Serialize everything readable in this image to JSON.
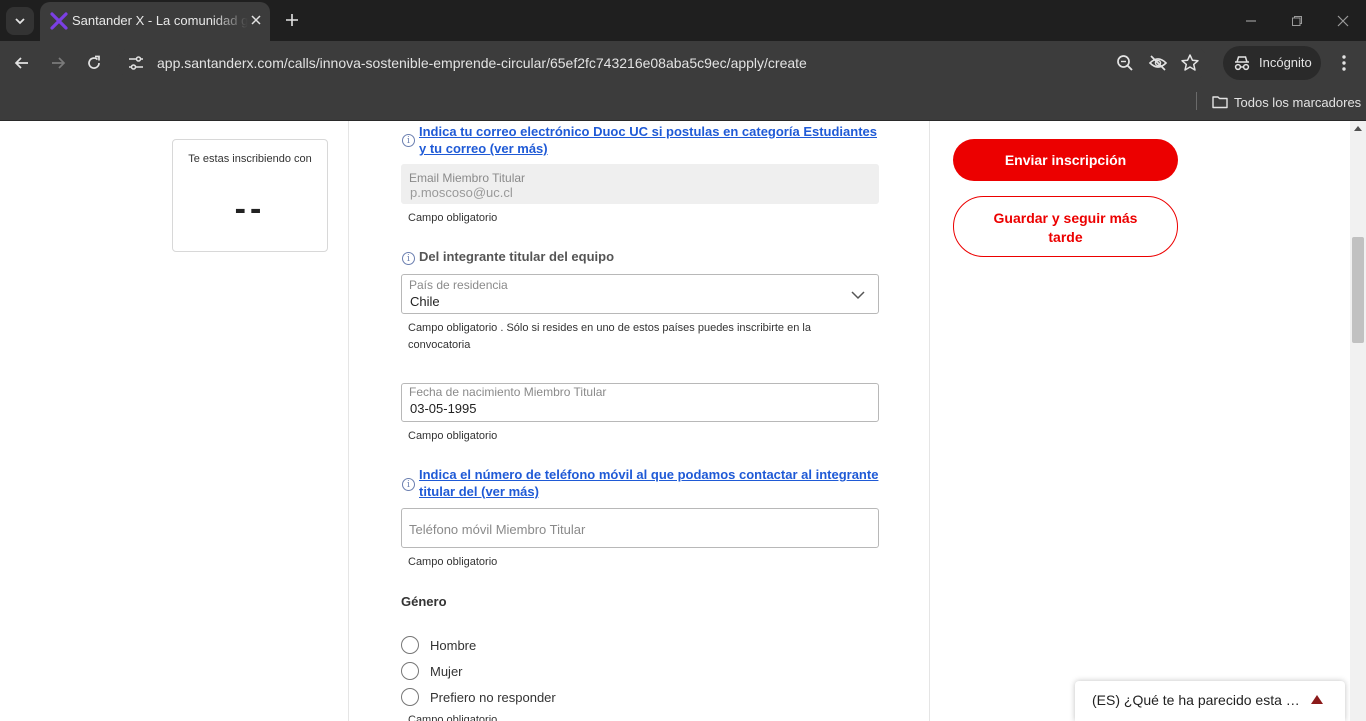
{
  "browser": {
    "tab_title": "Santander X - La comunidad global de emprendedores",
    "url": "app.santanderx.com/calls/innova-sostenible-emprende-circular/65ef2fc743216e08aba5c9ec/apply/create",
    "incognito_label": "Incógnito",
    "bookmarks_label": "Todos los marcadores"
  },
  "enrollment_card": {
    "title": "Te estas inscribiendo con",
    "value": "--"
  },
  "form": {
    "email_question": "Indica tu correo electrónico Duoc UC si postulas en categoría Estudiantes y tu correo (ver más)",
    "email_label": "Email Miembro Titular",
    "email_value": "p.moscoso@uc.cl",
    "email_hint": "Campo obligatorio",
    "titular_question": "Del integrante titular del equipo",
    "country_label": "País de residencia",
    "country_value": "Chile",
    "country_hint": "Campo obligatorio . Sólo si resides en uno de estos países puedes inscribirte en la convocatoria",
    "birth_label": "Fecha de nacimiento Miembro Titular",
    "birth_value": "03-05-1995",
    "birth_hint": "Campo obligatorio",
    "phone_question": "Indica el número de teléfono móvil al que podamos contactar al integrante titular del (ver más)",
    "phone_placeholder": "Teléfono móvil Miembro Titular",
    "phone_hint": "Campo obligatorio",
    "gender_title": "Género",
    "gender_options": [
      "Hombre",
      "Mujer",
      "Prefiero no responder"
    ],
    "gender_hint": "Campo obligatorio"
  },
  "actions": {
    "submit_label": "Enviar inscripción",
    "save_label": "Guardar y seguir más tarde"
  },
  "feedback": {
    "label": "(ES) ¿Qué te ha parecido esta experiencia?"
  },
  "colors": {
    "accent": "#ec0000",
    "link": "#1f5ad6"
  }
}
